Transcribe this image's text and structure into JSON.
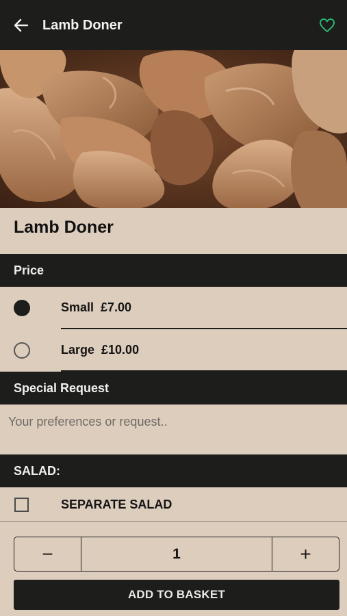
{
  "header": {
    "title": "Lamb Doner",
    "back_icon": "arrow-left-icon",
    "favorite_icon": "heart-outline-icon",
    "favorite_color": "#2bb673"
  },
  "product": {
    "image": "lamb-doner-photo",
    "name": "Lamb Doner"
  },
  "price_section": {
    "heading": "Price",
    "options": [
      {
        "label": "Small  £7.00",
        "selected": true
      },
      {
        "label": "Large  £10.00",
        "selected": false
      }
    ]
  },
  "special_request": {
    "heading": "Special Request",
    "placeholder": "Your preferences or request..",
    "value": ""
  },
  "salad_section": {
    "heading": "SALAD:",
    "options": [
      {
        "label": "SEPARATE SALAD",
        "checked": false
      }
    ]
  },
  "quantity": {
    "minus": "−",
    "value": "1",
    "plus": "+"
  },
  "basket_button": "ADD TO BASKET",
  "colors": {
    "background": "#ddcdbd",
    "bar": "#1d1d1b"
  }
}
